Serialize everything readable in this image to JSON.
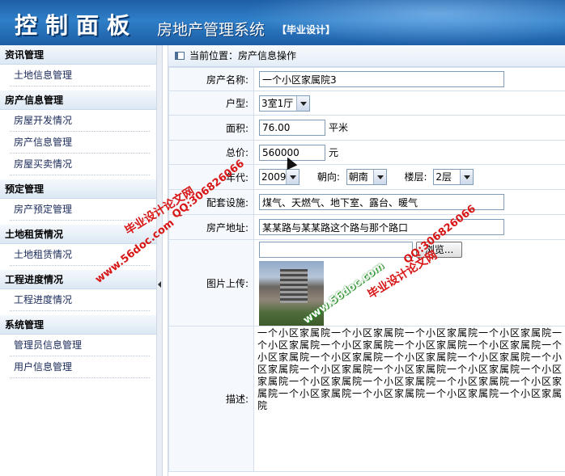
{
  "header": {
    "logo": "控制面板",
    "system_name": "房地产管理系统",
    "tag": "【毕业设计】"
  },
  "sidebar": {
    "groups": [
      {
        "title": "资讯管理",
        "items": [
          "土地信息管理"
        ]
      },
      {
        "title": "房产信息管理",
        "items": [
          "房屋开发情况",
          "房产信息管理",
          "房屋买卖情况"
        ]
      },
      {
        "title": "预定管理",
        "items": [
          "房产预定管理"
        ]
      },
      {
        "title": "土地租赁情况",
        "items": [
          "土地租赁情况"
        ]
      },
      {
        "title": "工程进度情况",
        "items": [
          "工程进度情况"
        ]
      },
      {
        "title": "系统管理",
        "items": [
          "管理员信息管理",
          "用户信息管理"
        ]
      }
    ]
  },
  "breadcrumb": "当前位置：房产信息操作",
  "form": {
    "name_label": "房产名称:",
    "name_value": "一个小区家属院3",
    "type_label": "户型:",
    "type_value": "3室1厅",
    "area_label": "面积:",
    "area_value": "76.00",
    "area_unit": "平米",
    "price_label": "总价:",
    "price_value": "560000",
    "price_unit": "元",
    "year_label": "年代:",
    "year_value": "2009",
    "orient_label": "朝向:",
    "orient_value": "朝南",
    "floor_label": "楼层:",
    "floor_value": "2层",
    "facility_label": "配套设施:",
    "facility_value": "煤气、天燃气、地下室、露台、暖气",
    "address_label": "房产地址:",
    "address_value": "某某路与某某路这个路与那个路口",
    "upload_label": "图片上传:",
    "browse_label": "浏览...",
    "desc_label": "描述:",
    "desc_value": "一个小区家属院一个小区家属院一个小区家属院一个小区家属院一个小区家属院一个小区家属院一个小区家属院一个小区家属院一个小区家属院一个小区家属院一个小区家属院一个小区家属院一个小区家属院一个小区家属院一个小区家属院一个小区家属院一个小区家属院一个小区家属院一个小区家属院一个小区家属院一个小区家属院一个小区家属院一个小区家属院一个小区家属院一个小区家属院"
  },
  "watermarks": {
    "site": "www.56doc.com",
    "qq": "QQ:306826066",
    "name": "毕业设计论文网"
  },
  "colors": {
    "header_blue": "#2f7fc8",
    "watermark_red": "#d81616",
    "watermark_green": "#1d8a1d"
  }
}
